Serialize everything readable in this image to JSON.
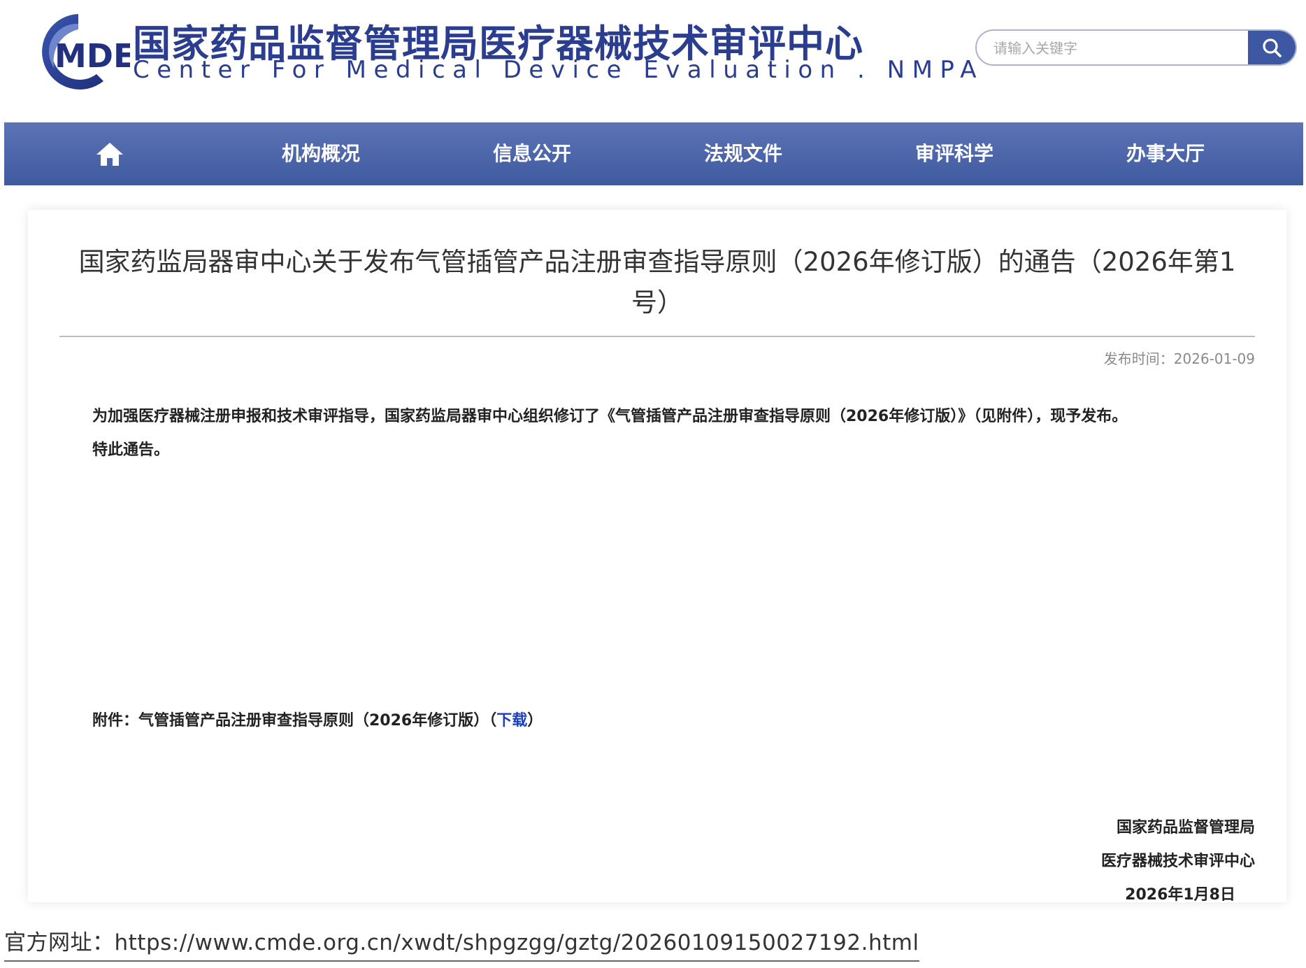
{
  "header": {
    "logo_text": "MDE",
    "title_cn": "国家药品监督管理局医疗器械技术审评中心",
    "title_en": "Center For Medical Device Evaluation . NMPA",
    "search": {
      "placeholder": "请输入关键字",
      "value": ""
    }
  },
  "nav": {
    "items": [
      {
        "label": "机构概况"
      },
      {
        "label": "信息公开"
      },
      {
        "label": "法规文件"
      },
      {
        "label": "审评科学"
      },
      {
        "label": "办事大厅"
      }
    ]
  },
  "article": {
    "title": "国家药监局器审中心关于发布气管插管产品注册审查指导原则（2026年修订版）的通告（2026年第1号）",
    "publish_time": "发布时间：2026-01-09",
    "paragraph_1": "为加强医疗器械注册申报和技术审评指导，国家药监局器审中心组织修订了《气管插管产品注册审查指导原则（2026年修订版）》（见附件），现予发布。",
    "paragraph_2": "特此通告。",
    "attachment_label": "附件：气管插管产品注册审查指导原则（2026年修订版）（",
    "download_label": "下载",
    "attachment_close": "）",
    "signature": {
      "org_1": "国家药品监督管理局",
      "org_2": "医疗器械技术审评中心",
      "date": "2026年1月8日"
    }
  },
  "footer": {
    "url_label": "官方网址：https://www.cmde.org.cn/xwdt/shpgzgg/gztg/20260109150027192.html"
  },
  "colors": {
    "brand_blue": "#2b3d8f",
    "nav_blue": "#4a63a8",
    "link_blue": "#1a3fc0"
  }
}
